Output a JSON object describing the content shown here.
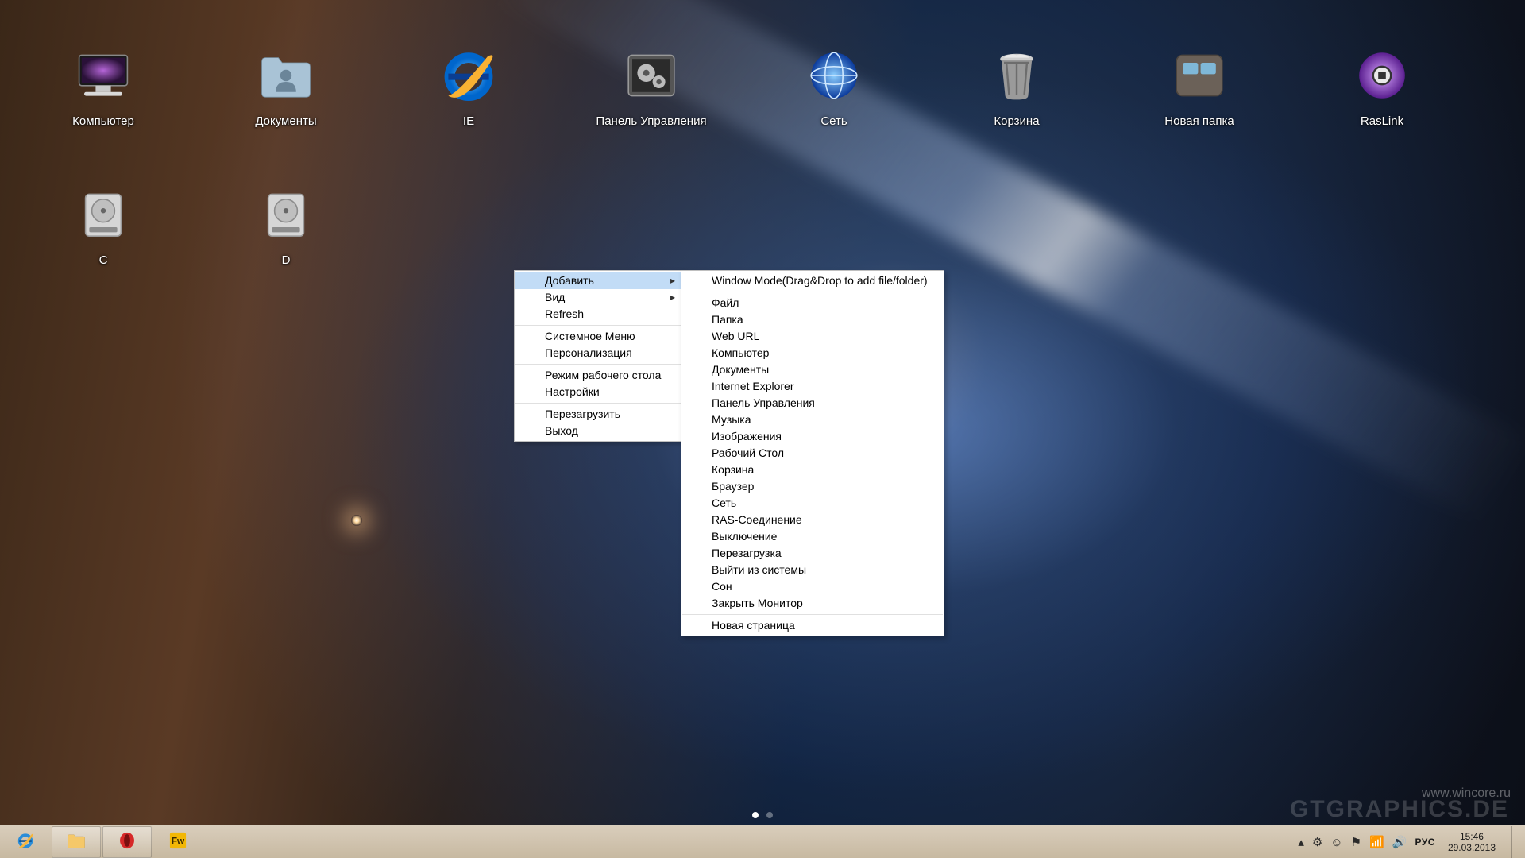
{
  "desktop_icons": [
    {
      "id": "computer",
      "label": "Компьютер",
      "icon": "computer-icon"
    },
    {
      "id": "documents",
      "label": "Документы",
      "icon": "folder-user-icon"
    },
    {
      "id": "ie",
      "label": "IE",
      "icon": "ie-icon"
    },
    {
      "id": "control-panel",
      "label": "Панель Управления",
      "icon": "gears-panel-icon"
    },
    {
      "id": "network",
      "label": "Сеть",
      "icon": "globe-icon"
    },
    {
      "id": "trash",
      "label": "Корзина",
      "icon": "trash-icon"
    },
    {
      "id": "new-folder",
      "label": "Новая папка",
      "icon": "folder-tile-icon"
    },
    {
      "id": "raslink",
      "label": "RasLink",
      "icon": "raslink-icon"
    },
    {
      "id": "drive-c",
      "label": "C",
      "icon": "hdd-icon"
    },
    {
      "id": "drive-d",
      "label": "D",
      "icon": "hdd-icon"
    }
  ],
  "context_menu": {
    "items": [
      {
        "label": "Добавить",
        "submenu": true,
        "highlighted": true
      },
      {
        "label": "Вид",
        "submenu": true
      },
      {
        "label": "Refresh"
      },
      {
        "sep": true
      },
      {
        "label": "Системное Меню"
      },
      {
        "label": "Персонализация"
      },
      {
        "sep": true
      },
      {
        "label": "Режим рабочего стола"
      },
      {
        "label": "Настройки"
      },
      {
        "sep": true
      },
      {
        "label": "Перезагрузить"
      },
      {
        "label": "Выход"
      }
    ],
    "submenu_items": [
      {
        "label": "Window Mode(Drag&Drop to add file/folder)"
      },
      {
        "sep": true
      },
      {
        "label": "Файл"
      },
      {
        "label": "Папка"
      },
      {
        "label": "Web URL"
      },
      {
        "label": "Компьютер"
      },
      {
        "label": "Документы"
      },
      {
        "label": "Internet Explorer"
      },
      {
        "label": "Панель Управления"
      },
      {
        "label": "Музыка"
      },
      {
        "label": "Изображения"
      },
      {
        "label": "Рабочий Стол"
      },
      {
        "label": "Корзина"
      },
      {
        "label": "Браузер"
      },
      {
        "label": "Сеть"
      },
      {
        "label": "RAS-Соединение"
      },
      {
        "label": "Выключение"
      },
      {
        "label": "Перезагрузка"
      },
      {
        "label": "Выйти из системы"
      },
      {
        "label": "Сон"
      },
      {
        "label": "Закрыть Монитор"
      },
      {
        "sep": true
      },
      {
        "label": "Новая страница"
      }
    ]
  },
  "pager": {
    "count": 2,
    "active": 0
  },
  "taskbar": {
    "pinned": [
      "ie",
      "explorer",
      "opera",
      "fireworks"
    ],
    "tray_icons": [
      "chevron-up-icon",
      "settings-tray-icon",
      "smiley-icon",
      "security-icon",
      "network-tray-icon",
      "volume-icon"
    ],
    "language": "РУС",
    "clock": {
      "time": "15:46",
      "date": "29.03.2013"
    }
  },
  "watermark": {
    "main": "GTGRAPHICS.DE",
    "site": "www.wincore.ru"
  }
}
